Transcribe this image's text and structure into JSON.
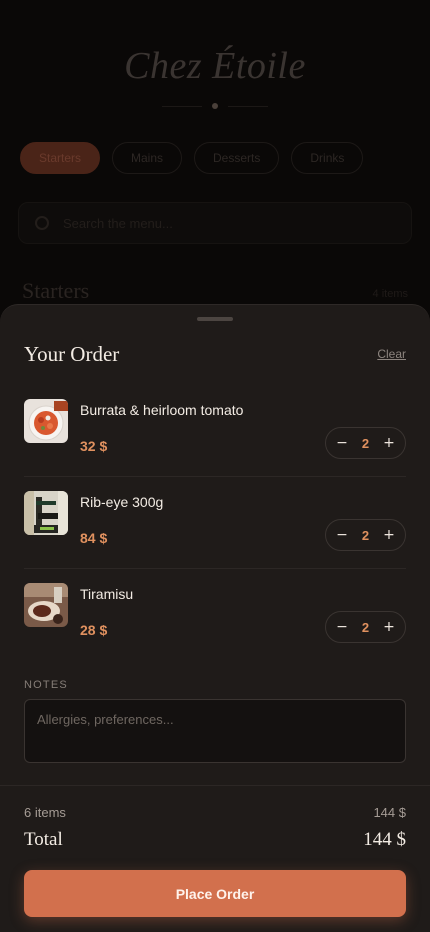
{
  "background": {
    "brand": "Chez Étoile",
    "categories": [
      "Starters",
      "Mains",
      "Desserts",
      "Drinks"
    ],
    "search_placeholder": "Search the menu...",
    "section_title": "Starters",
    "section_count": "4 items"
  },
  "order": {
    "title": "Your Order",
    "clear_label": "Clear",
    "items": [
      {
        "name": "Burrata & heirloom tomato",
        "price": "32 $",
        "qty": "2",
        "minus": "−",
        "plus": "+"
      },
      {
        "name": "Rib-eye 300g",
        "price": "84 $",
        "qty": "2",
        "minus": "−",
        "plus": "+"
      },
      {
        "name": "Tiramisu",
        "price": "28 $",
        "qty": "2",
        "minus": "−",
        "plus": "+"
      }
    ],
    "notes_label": "NOTES",
    "notes_placeholder": "Allergies, preferences...",
    "subtotal_label": "6 items",
    "subtotal_value": "144 $",
    "total_label": "Total",
    "total_value": "144 $",
    "place_order_label": "Place Order"
  },
  "colors": {
    "accent": "#d2704d",
    "price": "#e0915f",
    "sheet_bg": "#1f1b19"
  }
}
